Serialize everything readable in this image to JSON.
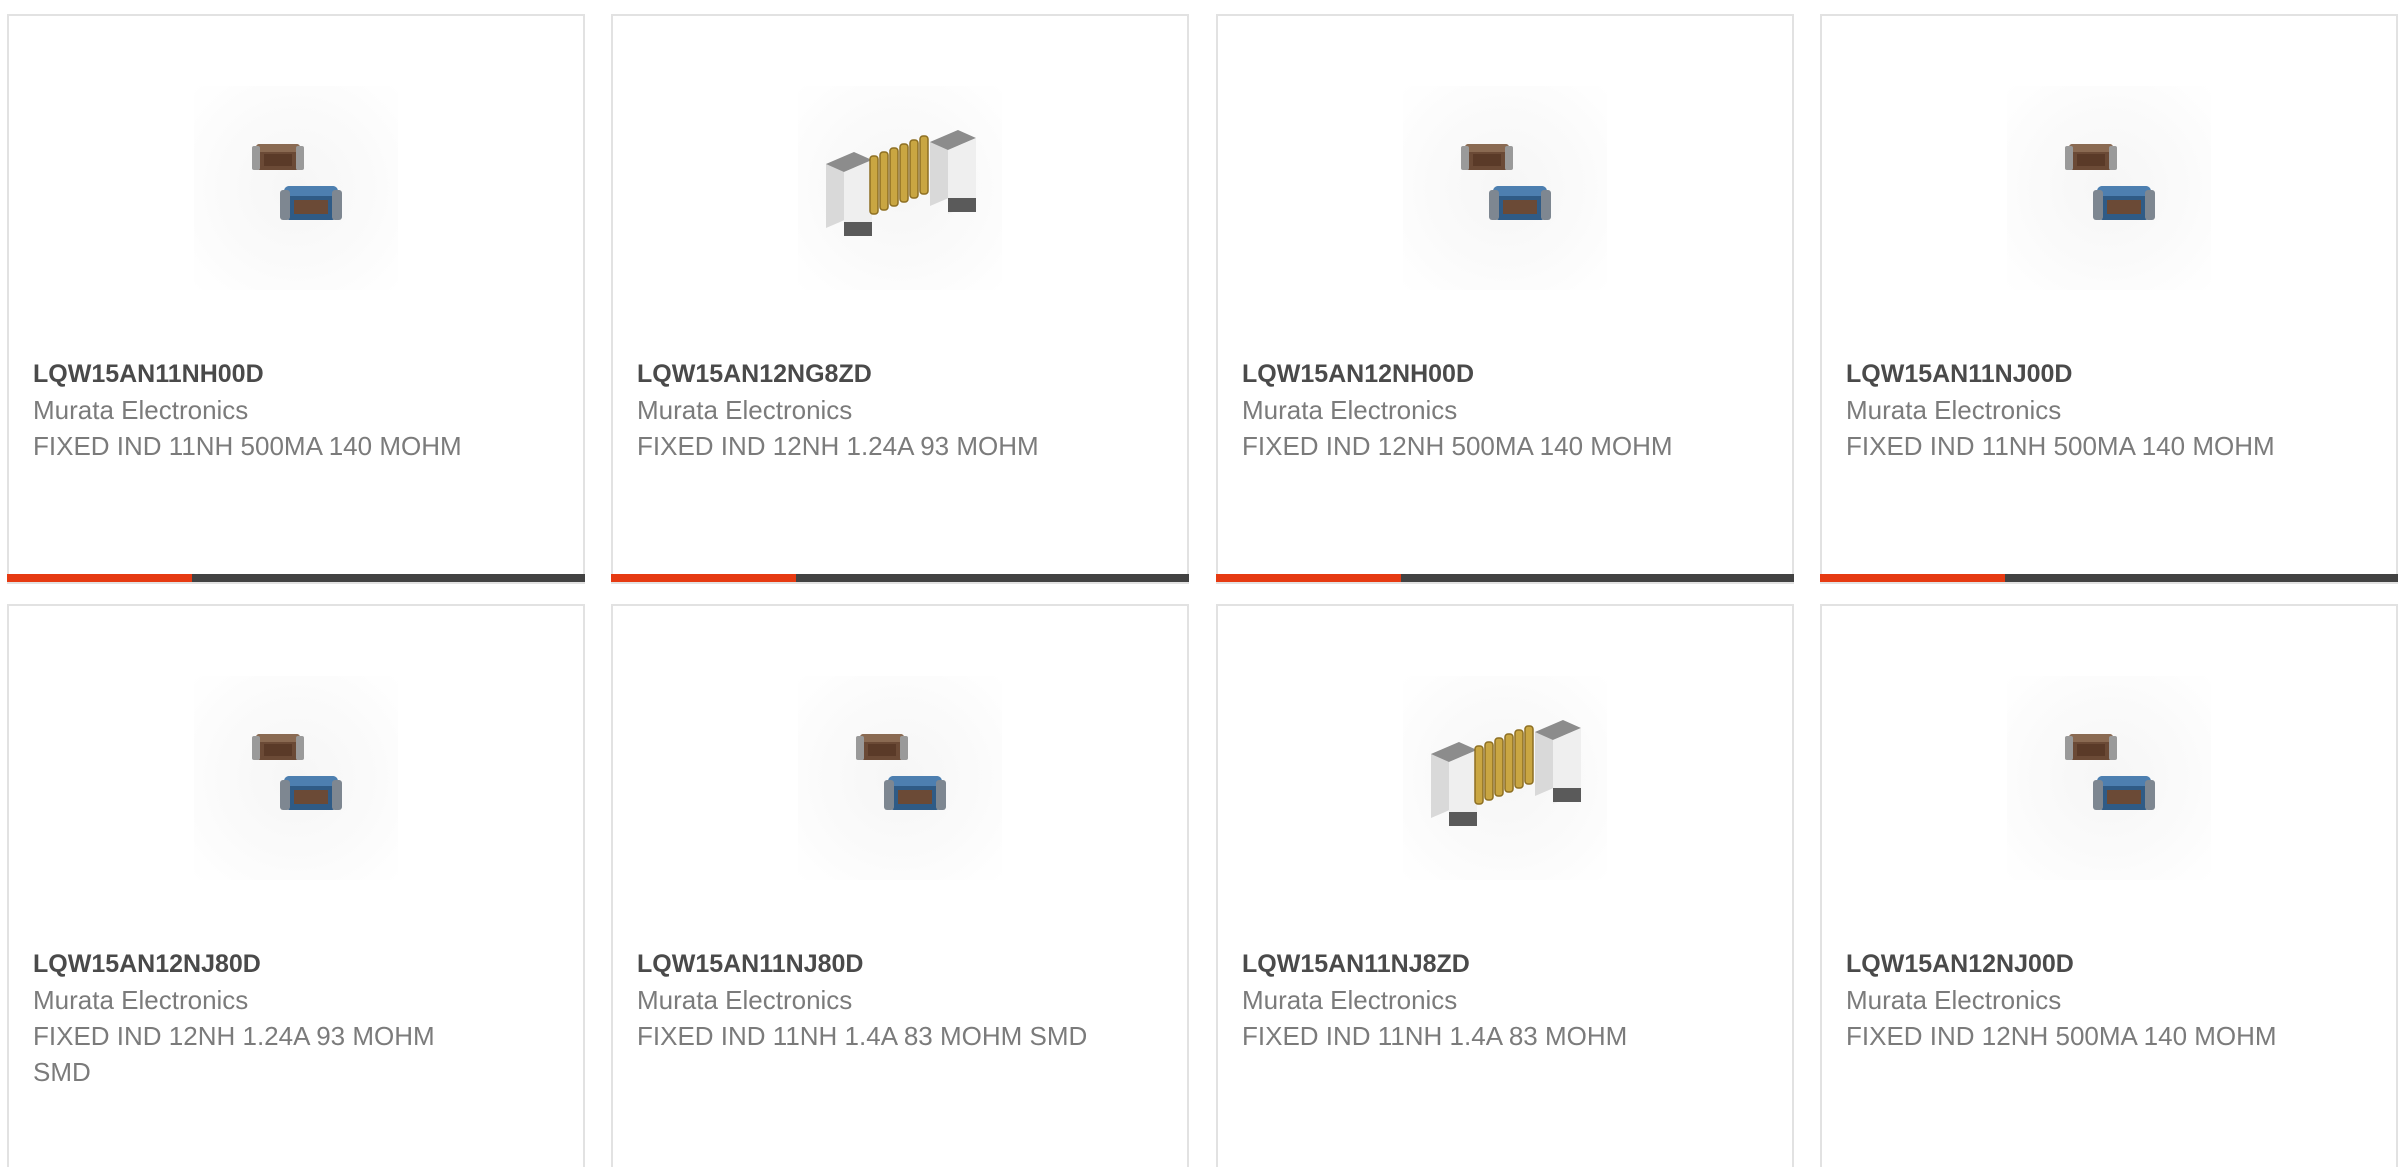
{
  "colors": {
    "accent": "#e63a12",
    "bar_track": "#424242",
    "part_text": "#4a4a4a",
    "secondary_text": "#7b7b7b",
    "card_border": "#e2e2e2"
  },
  "products": [
    {
      "part": "LQW15AN11NH00D",
      "manufacturer": "Murata Electronics",
      "description": "FIXED IND 11NH 500MA 140 MOHM",
      "image": "dual-chip-inductor-photo"
    },
    {
      "part": "LQW15AN12NG8ZD",
      "manufacturer": "Murata Electronics",
      "description": "FIXED IND 12NH 1.24A 93 MOHM",
      "image": "wirewound-chip-inductor-photo"
    },
    {
      "part": "LQW15AN12NH00D",
      "manufacturer": "Murata Electronics",
      "description": "FIXED IND 12NH 500MA 140 MOHM",
      "image": "dual-chip-inductor-photo"
    },
    {
      "part": "LQW15AN11NJ00D",
      "manufacturer": "Murata Electronics",
      "description": "FIXED IND 11NH 500MA 140 MOHM",
      "image": "dual-chip-inductor-photo"
    },
    {
      "part": "LQW15AN12NJ80D",
      "manufacturer": "Murata Electronics",
      "description": "FIXED IND 12NH 1.24A 93 MOHM SMD",
      "image": "dual-chip-inductor-photo"
    },
    {
      "part": "LQW15AN11NJ80D",
      "manufacturer": "Murata Electronics",
      "description": "FIXED IND 11NH 1.4A 83 MOHM SMD",
      "image": "dual-chip-inductor-photo"
    },
    {
      "part": "LQW15AN11NJ8ZD",
      "manufacturer": "Murata Electronics",
      "description": "FIXED IND 11NH 1.4A 83 MOHM",
      "image": "wirewound-chip-inductor-photo"
    },
    {
      "part": "LQW15AN12NJ00D",
      "manufacturer": "Murata Electronics",
      "description": "FIXED IND 12NH 500MA 140 MOHM",
      "image": "dual-chip-inductor-photo"
    }
  ]
}
